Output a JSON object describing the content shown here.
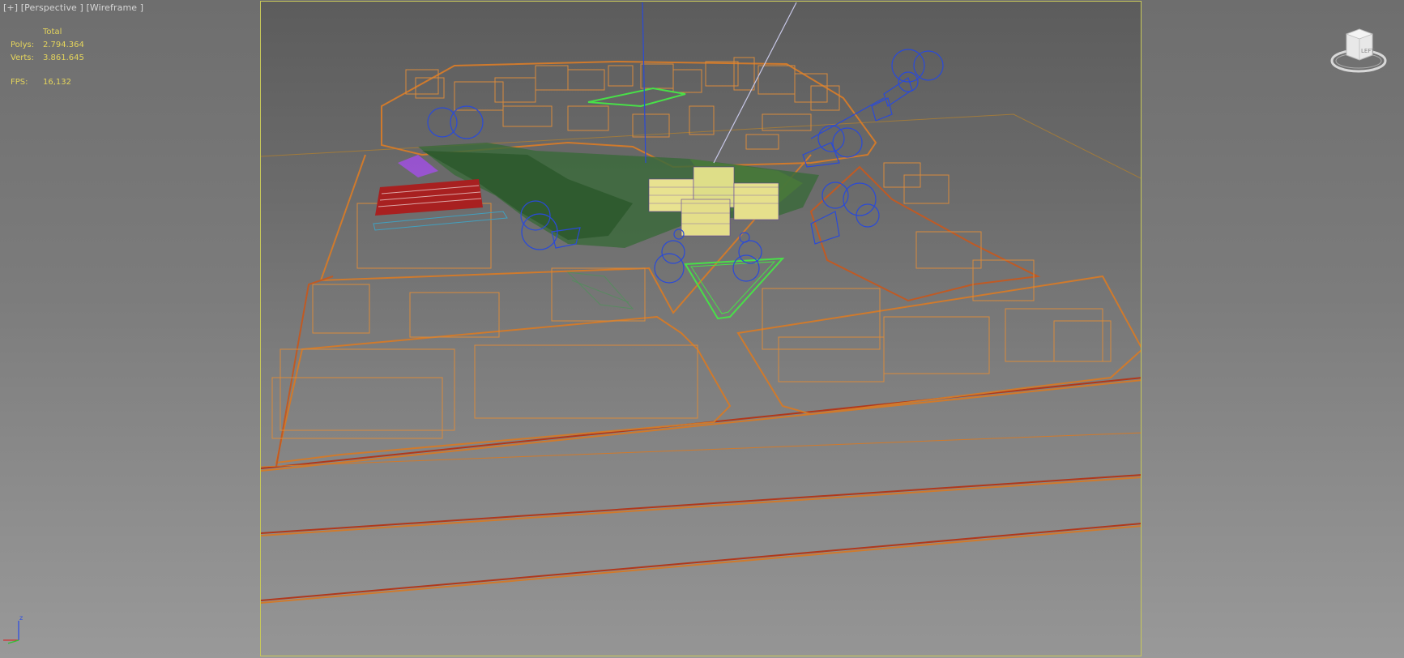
{
  "viewport": {
    "label_parts": [
      "[+]",
      "[Perspective ]",
      "[Wireframe ]"
    ],
    "stats": {
      "header": "Total",
      "polys_label": "Polys:",
      "polys_value": "2.794.364",
      "verts_label": "Verts:",
      "verts_value": "3.861.645",
      "fps_label": "FPS:",
      "fps_value": "16,132"
    },
    "viewcube": {
      "face_label": "LEFT"
    },
    "axis_tripod": {
      "z_label": "z"
    },
    "colors": {
      "stats_text": "#e4d45c",
      "safe_frame": "#c8c85a",
      "building_wire": "#d88a3c",
      "road_outline": "#b0381c",
      "camera_wire": "#2a4ad8",
      "vegetation": "#3c6a3c",
      "highlight_green": "#48e048"
    }
  }
}
